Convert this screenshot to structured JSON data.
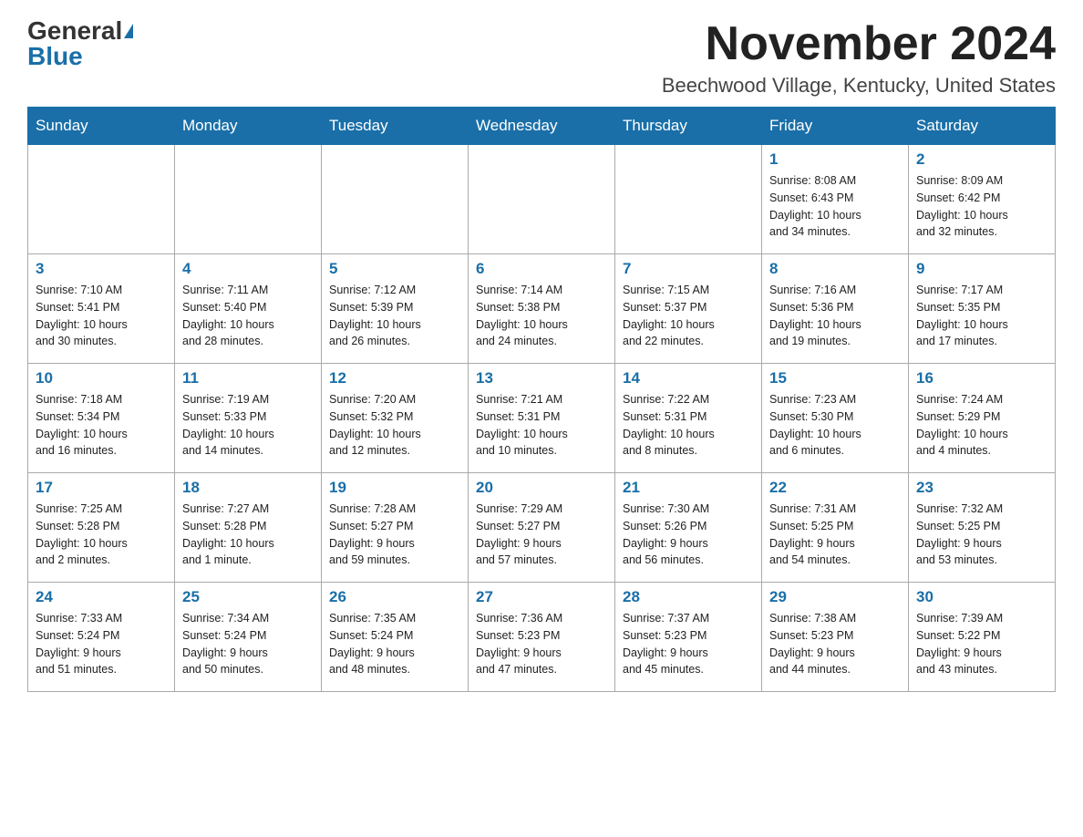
{
  "header": {
    "logo_general": "General",
    "logo_blue": "Blue",
    "month": "November 2024",
    "location": "Beechwood Village, Kentucky, United States"
  },
  "days_of_week": [
    "Sunday",
    "Monday",
    "Tuesday",
    "Wednesday",
    "Thursday",
    "Friday",
    "Saturday"
  ],
  "weeks": [
    [
      {
        "day": "",
        "info": ""
      },
      {
        "day": "",
        "info": ""
      },
      {
        "day": "",
        "info": ""
      },
      {
        "day": "",
        "info": ""
      },
      {
        "day": "",
        "info": ""
      },
      {
        "day": "1",
        "info": "Sunrise: 8:08 AM\nSunset: 6:43 PM\nDaylight: 10 hours\nand 34 minutes."
      },
      {
        "day": "2",
        "info": "Sunrise: 8:09 AM\nSunset: 6:42 PM\nDaylight: 10 hours\nand 32 minutes."
      }
    ],
    [
      {
        "day": "3",
        "info": "Sunrise: 7:10 AM\nSunset: 5:41 PM\nDaylight: 10 hours\nand 30 minutes."
      },
      {
        "day": "4",
        "info": "Sunrise: 7:11 AM\nSunset: 5:40 PM\nDaylight: 10 hours\nand 28 minutes."
      },
      {
        "day": "5",
        "info": "Sunrise: 7:12 AM\nSunset: 5:39 PM\nDaylight: 10 hours\nand 26 minutes."
      },
      {
        "day": "6",
        "info": "Sunrise: 7:14 AM\nSunset: 5:38 PM\nDaylight: 10 hours\nand 24 minutes."
      },
      {
        "day": "7",
        "info": "Sunrise: 7:15 AM\nSunset: 5:37 PM\nDaylight: 10 hours\nand 22 minutes."
      },
      {
        "day": "8",
        "info": "Sunrise: 7:16 AM\nSunset: 5:36 PM\nDaylight: 10 hours\nand 19 minutes."
      },
      {
        "day": "9",
        "info": "Sunrise: 7:17 AM\nSunset: 5:35 PM\nDaylight: 10 hours\nand 17 minutes."
      }
    ],
    [
      {
        "day": "10",
        "info": "Sunrise: 7:18 AM\nSunset: 5:34 PM\nDaylight: 10 hours\nand 16 minutes."
      },
      {
        "day": "11",
        "info": "Sunrise: 7:19 AM\nSunset: 5:33 PM\nDaylight: 10 hours\nand 14 minutes."
      },
      {
        "day": "12",
        "info": "Sunrise: 7:20 AM\nSunset: 5:32 PM\nDaylight: 10 hours\nand 12 minutes."
      },
      {
        "day": "13",
        "info": "Sunrise: 7:21 AM\nSunset: 5:31 PM\nDaylight: 10 hours\nand 10 minutes."
      },
      {
        "day": "14",
        "info": "Sunrise: 7:22 AM\nSunset: 5:31 PM\nDaylight: 10 hours\nand 8 minutes."
      },
      {
        "day": "15",
        "info": "Sunrise: 7:23 AM\nSunset: 5:30 PM\nDaylight: 10 hours\nand 6 minutes."
      },
      {
        "day": "16",
        "info": "Sunrise: 7:24 AM\nSunset: 5:29 PM\nDaylight: 10 hours\nand 4 minutes."
      }
    ],
    [
      {
        "day": "17",
        "info": "Sunrise: 7:25 AM\nSunset: 5:28 PM\nDaylight: 10 hours\nand 2 minutes."
      },
      {
        "day": "18",
        "info": "Sunrise: 7:27 AM\nSunset: 5:28 PM\nDaylight: 10 hours\nand 1 minute."
      },
      {
        "day": "19",
        "info": "Sunrise: 7:28 AM\nSunset: 5:27 PM\nDaylight: 9 hours\nand 59 minutes."
      },
      {
        "day": "20",
        "info": "Sunrise: 7:29 AM\nSunset: 5:27 PM\nDaylight: 9 hours\nand 57 minutes."
      },
      {
        "day": "21",
        "info": "Sunrise: 7:30 AM\nSunset: 5:26 PM\nDaylight: 9 hours\nand 56 minutes."
      },
      {
        "day": "22",
        "info": "Sunrise: 7:31 AM\nSunset: 5:25 PM\nDaylight: 9 hours\nand 54 minutes."
      },
      {
        "day": "23",
        "info": "Sunrise: 7:32 AM\nSunset: 5:25 PM\nDaylight: 9 hours\nand 53 minutes."
      }
    ],
    [
      {
        "day": "24",
        "info": "Sunrise: 7:33 AM\nSunset: 5:24 PM\nDaylight: 9 hours\nand 51 minutes."
      },
      {
        "day": "25",
        "info": "Sunrise: 7:34 AM\nSunset: 5:24 PM\nDaylight: 9 hours\nand 50 minutes."
      },
      {
        "day": "26",
        "info": "Sunrise: 7:35 AM\nSunset: 5:24 PM\nDaylight: 9 hours\nand 48 minutes."
      },
      {
        "day": "27",
        "info": "Sunrise: 7:36 AM\nSunset: 5:23 PM\nDaylight: 9 hours\nand 47 minutes."
      },
      {
        "day": "28",
        "info": "Sunrise: 7:37 AM\nSunset: 5:23 PM\nDaylight: 9 hours\nand 45 minutes."
      },
      {
        "day": "29",
        "info": "Sunrise: 7:38 AM\nSunset: 5:23 PM\nDaylight: 9 hours\nand 44 minutes."
      },
      {
        "day": "30",
        "info": "Sunrise: 7:39 AM\nSunset: 5:22 PM\nDaylight: 9 hours\nand 43 minutes."
      }
    ]
  ]
}
